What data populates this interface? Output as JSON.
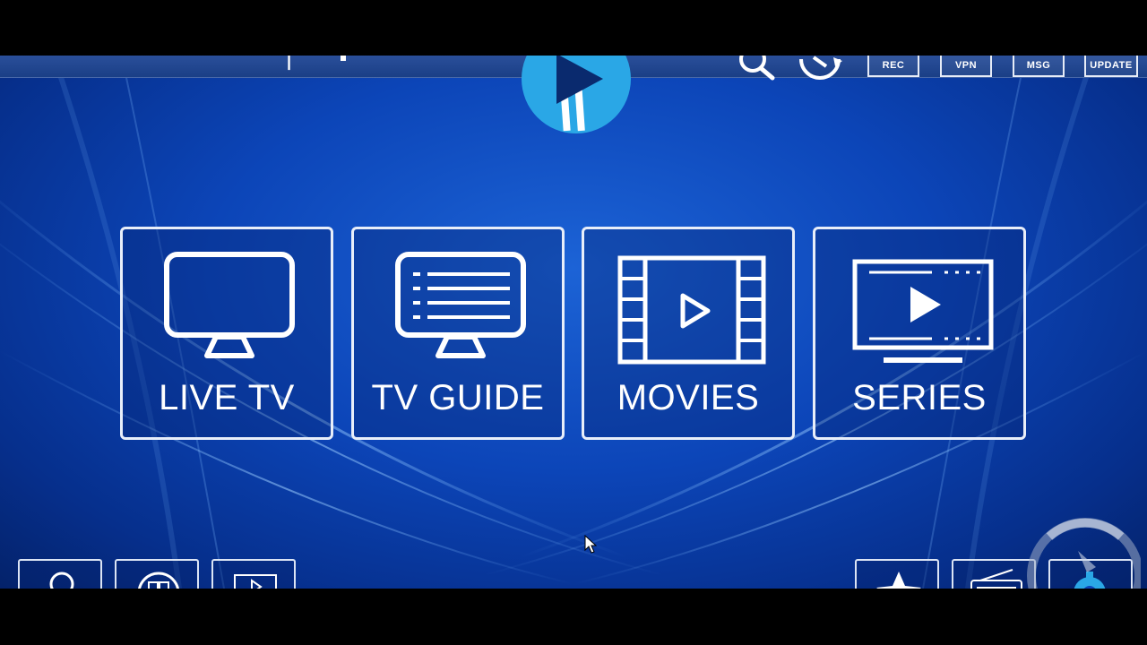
{
  "app": {
    "logo_icon": "play-logo-icon",
    "top_text": "|"
  },
  "top_toolbar": {
    "items": [
      {
        "name": "search",
        "icon": "search-icon",
        "label": ""
      },
      {
        "name": "refresh",
        "icon": "refresh-icon",
        "label": ""
      },
      {
        "name": "record",
        "icon": "rec-icon",
        "label": "REC"
      },
      {
        "name": "vpn",
        "icon": "vpn-icon",
        "label": "VPN"
      },
      {
        "name": "message",
        "icon": "mail-icon",
        "label": "MSG"
      },
      {
        "name": "update",
        "icon": "download-icon",
        "label": "UPDATE"
      }
    ]
  },
  "tiles": [
    {
      "label": "LIVE TV",
      "icon": "tv-icon"
    },
    {
      "label": "TV GUIDE",
      "icon": "tv-guide-icon"
    },
    {
      "label": "MOVIES",
      "icon": "film-play-icon"
    },
    {
      "label": "SERIES",
      "icon": "series-play-icon"
    }
  ],
  "bottom_left": [
    {
      "name": "account",
      "icon": "user-icon"
    },
    {
      "name": "multiscreen",
      "icon": "multiscreen-icon"
    },
    {
      "name": "catchup",
      "icon": "play-box-icon"
    }
  ],
  "bottom_right": [
    {
      "name": "favorites",
      "icon": "star-icon"
    },
    {
      "name": "radio",
      "icon": "radio-icon"
    },
    {
      "name": "settings",
      "icon": "gear-icon"
    }
  ],
  "colors": {
    "background": "#0c45b8",
    "tile_border": "#e8eef9",
    "logo_blue": "#2aa7e6"
  }
}
